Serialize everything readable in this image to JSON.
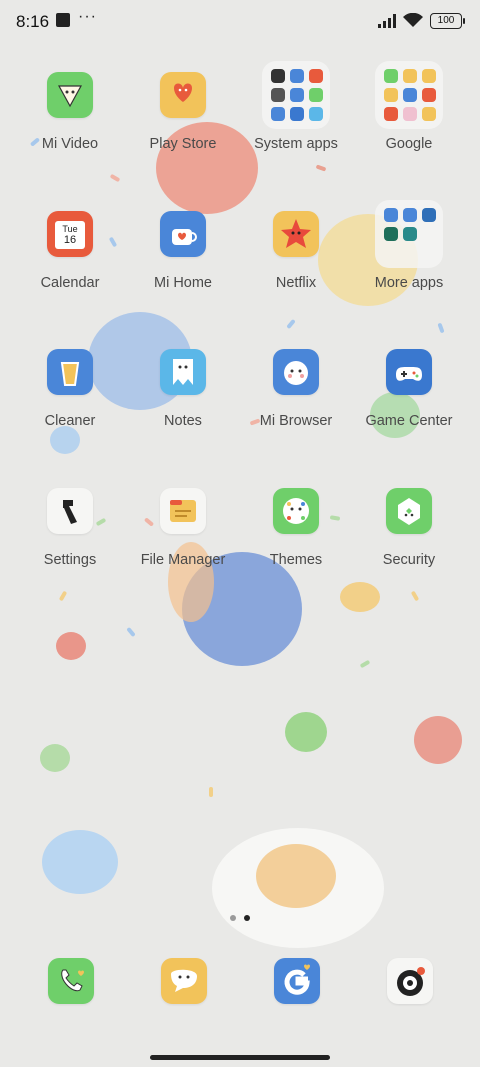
{
  "status_bar": {
    "time": "8:16",
    "more": "···",
    "battery": "100"
  },
  "apps": [
    {
      "label": "Mi Video",
      "icon": "mi-video-icon",
      "color": "#6fcf6a"
    },
    {
      "label": "Play Store",
      "icon": "play-store-icon",
      "color": "#f2c35a"
    },
    {
      "label": "System apps",
      "icon": "system-apps-folder-icon",
      "folder": true
    },
    {
      "label": "Google",
      "icon": "google-folder-icon",
      "folder": true
    },
    {
      "label": "Calendar",
      "icon": "calendar-icon",
      "color": "#e85a3c",
      "calendar_day": "Tue",
      "calendar_date": "16"
    },
    {
      "label": "Mi Home",
      "icon": "mi-home-icon",
      "color": "#4a86d8"
    },
    {
      "label": "Netflix",
      "icon": "netflix-icon",
      "color": "#f2c35a"
    },
    {
      "label": "More apps",
      "icon": "more-apps-folder-icon",
      "folder": true
    },
    {
      "label": "Cleaner",
      "icon": "cleaner-icon",
      "color": "#4a86d8"
    },
    {
      "label": "Notes",
      "icon": "notes-icon",
      "color": "#5bb7e8"
    },
    {
      "label": "Mi Browser",
      "icon": "mi-browser-icon",
      "color": "#4a86d8"
    },
    {
      "label": "Game Center",
      "icon": "game-center-icon",
      "color": "#3a78cf"
    },
    {
      "label": "Settings",
      "icon": "settings-icon",
      "color": "#f6f6f4"
    },
    {
      "label": "File Manager",
      "icon": "file-manager-icon",
      "color": "#f6f6f4"
    },
    {
      "label": "Themes",
      "icon": "themes-icon",
      "color": "#6fcf6a"
    },
    {
      "label": "Security",
      "icon": "security-icon",
      "color": "#6fcf6a"
    }
  ],
  "dock": [
    {
      "icon": "phone-icon",
      "color": "#6fcf6a"
    },
    {
      "icon": "messaging-icon",
      "color": "#f2c35a"
    },
    {
      "icon": "google-g-icon",
      "color": "#4a86d8"
    },
    {
      "icon": "camera-icon",
      "color": "#f6f6f4"
    }
  ],
  "page_indicator": {
    "pages": 2,
    "current": 2
  }
}
